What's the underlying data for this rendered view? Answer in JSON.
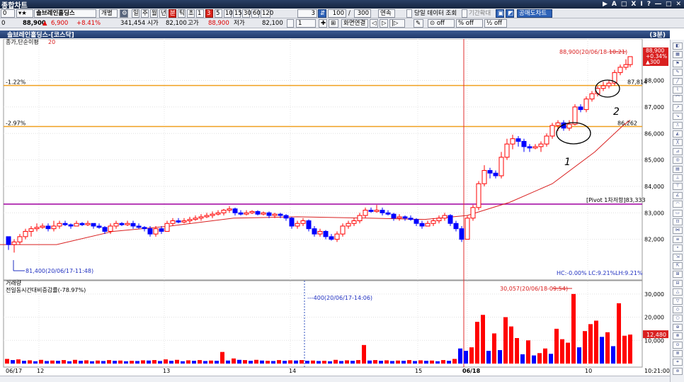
{
  "window": {
    "title": "종합차트",
    "controls": [
      "▶",
      "A",
      "□",
      "Ⅹ",
      "Ⅰ",
      "?",
      "―",
      "□",
      "✕"
    ]
  },
  "toolbar": {
    "code": "0",
    "stock_name": "솔브레인홀딩스",
    "individual_btn": "개별",
    "periods": [
      "일",
      "주",
      "월",
      "년",
      "분",
      "틱",
      "초",
      "1",
      "3",
      "5",
      "10",
      "15",
      "30",
      "60",
      "120"
    ],
    "selected_period": "분",
    "interval_value": "3",
    "count_value": "100",
    "count_total": "300",
    "continuous_btn": "연속",
    "today_data_label": "당일 데이터 조회",
    "period_expand_label": "기간확대",
    "buy_sell_btn": "공매도차트",
    "price": "88,900",
    "change_arrow": "▲",
    "change": "6,900",
    "change_pct": "+8.41%",
    "volume": "341,454",
    "open_label": "시가",
    "open": "82,100",
    "high_label": "고가",
    "high": "88,900",
    "low_label": "저가",
    "low": "82,100",
    "spin_value": "1",
    "screen_link_btn": "화면연결",
    "off_buttons": [
      "off",
      "off",
      "off"
    ]
  },
  "chart_caption": {
    "title": "솔브레인홀딩스-[코스닥]",
    "count": "(3분)"
  },
  "colors": {
    "up": "#ff0000",
    "down": "#0000ff",
    "ma": "#d92020",
    "hline_orange": "#f0a020",
    "pivot_line": "#a000a0",
    "vline": "#e03030"
  },
  "price_panel": {
    "label": "종가,단순이평",
    "ma_period": "20",
    "last_price_box": [
      "88,900",
      "+0.34%",
      "▲300"
    ],
    "annot_high": "88,900(20/06/18-10:21)",
    "annot_low": "81,400(20/06/17-11:48)",
    "line1_pct": "-1.22%",
    "line1_val": "87,814",
    "line2_pct": "-2.97%",
    "line2_val": "86,262",
    "pivot_label": "[Pivot 1차저항]83,333",
    "footer": [
      "HC:-0.00%",
      "LC:9.21%",
      "LH:9.21%"
    ],
    "y_ticks": [
      "88,000",
      "87,000",
      "86,000",
      "85,000",
      "84,000",
      "83,000",
      "82,000"
    ],
    "handwriting": [
      "1",
      "2"
    ]
  },
  "volume_panel": {
    "title": "거래량",
    "subtitle": "전일동시간대비증감률(-78.97%)",
    "annot_max": "30,057(20/06/18-09:54)",
    "annot_mark": "400(20/06/17-14:06)",
    "last_value_box": "12,480",
    "y_ticks": [
      "30,000",
      "20,000",
      "10,000"
    ]
  },
  "x_axis": {
    "labels": [
      "06/17",
      "12",
      "13",
      "14",
      "15",
      "06/18",
      "10",
      "10:21:00"
    ]
  },
  "chart_data": {
    "type": "candlestick",
    "y_range": [
      81.0,
      89.3
    ],
    "ma_points": [
      [
        0,
        81.8
      ],
      [
        20,
        81.8
      ],
      [
        80,
        81.8
      ],
      [
        160,
        82.3
      ],
      [
        240,
        82.5
      ],
      [
        330,
        82.8
      ],
      [
        420,
        82.85
      ],
      [
        520,
        82.8
      ],
      [
        600,
        82.75
      ],
      [
        660,
        82.9
      ],
      [
        720,
        83.4
      ],
      [
        780,
        84.1
      ],
      [
        840,
        85.3
      ],
      [
        880,
        86.3
      ],
      [
        890,
        86.5
      ]
    ],
    "candles": [
      [
        12,
        82.1,
        81.8,
        82.1,
        81.6
      ],
      [
        20,
        81.8,
        81.9,
        82.0,
        81.5
      ],
      [
        28,
        81.9,
        82.1,
        82.2,
        81.8
      ],
      [
        36,
        82.1,
        82.3,
        82.4,
        82.0
      ],
      [
        44,
        82.3,
        82.4,
        82.5,
        82.1
      ],
      [
        52,
        82.4,
        82.45,
        82.6,
        82.3
      ],
      [
        60,
        82.45,
        82.5,
        82.6,
        82.4
      ],
      [
        68,
        82.5,
        82.4,
        82.6,
        82.3
      ],
      [
        76,
        82.4,
        82.5,
        82.7,
        82.3
      ],
      [
        84,
        82.5,
        82.6,
        82.7,
        82.4
      ],
      [
        92,
        82.6,
        82.55,
        82.7,
        82.5
      ],
      [
        100,
        82.55,
        82.5,
        82.6,
        82.4
      ],
      [
        108,
        82.5,
        82.6,
        82.7,
        82.5
      ],
      [
        116,
        82.6,
        82.55,
        82.65,
        82.5
      ],
      [
        124,
        82.55,
        82.6,
        82.7,
        82.5
      ],
      [
        132,
        82.6,
        82.5,
        82.6,
        82.4
      ],
      [
        140,
        82.5,
        82.45,
        82.6,
        82.4
      ],
      [
        148,
        82.45,
        82.3,
        82.5,
        82.2
      ],
      [
        156,
        82.3,
        82.5,
        82.6,
        82.2
      ],
      [
        164,
        82.5,
        82.6,
        82.7,
        82.4
      ],
      [
        172,
        82.6,
        82.55,
        82.65,
        82.5
      ],
      [
        180,
        82.55,
        82.6,
        82.7,
        82.5
      ],
      [
        188,
        82.6,
        82.5,
        82.7,
        82.4
      ],
      [
        196,
        82.5,
        82.45,
        82.6,
        82.4
      ],
      [
        204,
        82.45,
        82.4,
        82.5,
        82.3
      ],
      [
        212,
        82.4,
        82.2,
        82.5,
        82.1
      ],
      [
        220,
        82.2,
        82.4,
        82.5,
        82.1
      ],
      [
        228,
        82.4,
        82.3,
        82.5,
        82.2
      ],
      [
        236,
        82.3,
        82.6,
        82.7,
        82.3
      ],
      [
        244,
        82.6,
        82.7,
        82.8,
        82.5
      ],
      [
        252,
        82.7,
        82.65,
        82.8,
        82.6
      ],
      [
        260,
        82.65,
        82.7,
        82.8,
        82.6
      ],
      [
        268,
        82.7,
        82.75,
        82.85,
        82.6
      ],
      [
        276,
        82.75,
        82.8,
        82.9,
        82.7
      ],
      [
        284,
        82.8,
        82.85,
        82.95,
        82.7
      ],
      [
        292,
        82.85,
        82.9,
        83.0,
        82.8
      ],
      [
        300,
        82.9,
        82.95,
        83.05,
        82.8
      ],
      [
        308,
        82.95,
        83.0,
        83.1,
        82.9
      ],
      [
        316,
        83.0,
        83.1,
        83.15,
        82.9
      ],
      [
        324,
        83.1,
        83.15,
        83.25,
        83.0
      ],
      [
        332,
        83.15,
        83.0,
        83.2,
        82.9
      ],
      [
        340,
        83.0,
        82.95,
        83.1,
        82.9
      ],
      [
        348,
        82.95,
        83.0,
        83.1,
        82.9
      ],
      [
        356,
        83.0,
        83.05,
        83.1,
        82.95
      ],
      [
        364,
        83.05,
        82.95,
        83.1,
        82.9
      ],
      [
        372,
        82.95,
        83.0,
        83.05,
        82.9
      ],
      [
        380,
        83.0,
        82.9,
        83.05,
        82.8
      ],
      [
        388,
        82.9,
        82.95,
        83.0,
        82.8
      ],
      [
        396,
        82.95,
        82.9,
        83.0,
        82.8
      ],
      [
        404,
        82.9,
        82.8,
        82.95,
        82.7
      ],
      [
        412,
        82.8,
        82.5,
        82.85,
        82.4
      ],
      [
        420,
        82.5,
        82.6,
        82.7,
        82.4
      ],
      [
        428,
        82.6,
        82.7,
        82.8,
        82.5
      ],
      [
        436,
        82.7,
        82.4,
        82.75,
        82.3
      ],
      [
        444,
        82.4,
        82.2,
        82.5,
        82.1
      ],
      [
        452,
        82.2,
        82.3,
        82.4,
        82.1
      ],
      [
        460,
        82.3,
        82.1,
        82.35,
        82.0
      ],
      [
        468,
        82.1,
        82.0,
        82.2,
        81.95
      ],
      [
        476,
        82.0,
        82.2,
        82.3,
        81.9
      ],
      [
        484,
        82.2,
        82.5,
        82.6,
        82.1
      ],
      [
        492,
        82.5,
        82.6,
        82.7,
        82.4
      ],
      [
        500,
        82.6,
        82.7,
        82.8,
        82.5
      ],
      [
        508,
        82.7,
        82.9,
        83.0,
        82.6
      ],
      [
        516,
        82.9,
        83.1,
        83.2,
        82.8
      ],
      [
        524,
        83.1,
        83.05,
        83.2,
        83.0
      ],
      [
        532,
        83.05,
        83.1,
        83.3,
        83.0
      ],
      [
        540,
        83.1,
        83.0,
        83.2,
        82.9
      ],
      [
        548,
        83.0,
        82.95,
        83.1,
        82.9
      ],
      [
        556,
        82.95,
        82.8,
        83.0,
        82.7
      ],
      [
        564,
        82.8,
        82.85,
        82.95,
        82.7
      ],
      [
        572,
        82.85,
        82.8,
        82.9,
        82.7
      ],
      [
        580,
        82.8,
        82.75,
        82.9,
        82.7
      ],
      [
        588,
        82.75,
        82.6,
        82.8,
        82.5
      ],
      [
        596,
        82.6,
        82.5,
        82.7,
        82.4
      ],
      [
        604,
        82.5,
        82.6,
        82.7,
        82.5
      ],
      [
        612,
        82.6,
        82.7,
        82.8,
        82.5
      ],
      [
        620,
        82.7,
        82.8,
        82.9,
        82.6
      ],
      [
        628,
        82.8,
        82.9,
        83.0,
        82.7
      ],
      [
        636,
        82.9,
        82.6,
        82.95,
        82.5
      ],
      [
        644,
        82.6,
        82.4,
        82.7,
        82.3
      ],
      [
        652,
        82.4,
        82.0,
        82.5,
        81.9
      ],
      [
        660,
        82.0,
        82.8,
        82.9,
        82.0
      ],
      [
        668,
        82.8,
        83.2,
        83.3,
        82.7
      ],
      [
        676,
        83.2,
        84.1,
        84.2,
        83.1
      ],
      [
        684,
        84.1,
        84.6,
        84.8,
        84.0
      ],
      [
        692,
        84.6,
        84.5,
        84.7,
        84.3
      ],
      [
        700,
        84.5,
        84.4,
        84.6,
        84.3
      ],
      [
        708,
        84.4,
        85.1,
        85.3,
        84.3
      ],
      [
        716,
        85.1,
        85.6,
        85.8,
        85.0
      ],
      [
        724,
        85.6,
        85.8,
        85.95,
        85.4
      ],
      [
        732,
        85.8,
        85.7,
        85.9,
        85.5
      ],
      [
        740,
        85.7,
        85.5,
        85.8,
        85.3
      ],
      [
        748,
        85.5,
        85.45,
        85.6,
        85.3
      ],
      [
        756,
        85.45,
        85.5,
        85.6,
        85.4
      ],
      [
        764,
        85.5,
        85.6,
        85.7,
        85.3
      ],
      [
        772,
        85.6,
        85.9,
        86.0,
        85.5
      ],
      [
        780,
        85.9,
        86.3,
        86.4,
        85.8
      ],
      [
        788,
        86.3,
        86.4,
        86.5,
        86.1
      ],
      [
        796,
        86.4,
        86.2,
        86.5,
        86.1
      ],
      [
        804,
        86.2,
        86.35,
        86.5,
        86.1
      ],
      [
        812,
        86.35,
        87.0,
        87.1,
        86.3
      ],
      [
        820,
        87.0,
        86.9,
        87.1,
        86.8
      ],
      [
        828,
        86.9,
        87.3,
        87.4,
        86.8
      ],
      [
        836,
        87.3,
        87.5,
        87.6,
        87.2
      ],
      [
        844,
        87.5,
        87.7,
        87.8,
        87.4
      ],
      [
        852,
        87.7,
        87.8,
        87.95,
        87.6
      ],
      [
        860,
        87.8,
        87.9,
        88.0,
        87.7
      ],
      [
        868,
        87.9,
        88.3,
        88.4,
        87.8
      ],
      [
        876,
        88.3,
        88.5,
        88.6,
        88.2
      ],
      [
        884,
        88.5,
        88.6,
        88.8,
        88.4
      ],
      [
        890,
        88.6,
        88.9,
        88.9,
        88.5
      ]
    ],
    "volume": [
      [
        10,
        1,
        2.0
      ],
      [
        18,
        0,
        1.5
      ],
      [
        26,
        1,
        1.8
      ],
      [
        34,
        0,
        1.2
      ],
      [
        42,
        1,
        1.4
      ],
      [
        50,
        0,
        1.0
      ],
      [
        58,
        1,
        1.6
      ],
      [
        66,
        0,
        1.1
      ],
      [
        74,
        1,
        1.3
      ],
      [
        82,
        0,
        1.2
      ],
      [
        90,
        1,
        1.5
      ],
      [
        98,
        0,
        1.0
      ],
      [
        106,
        1,
        1.6
      ],
      [
        114,
        0,
        1.2
      ],
      [
        122,
        1,
        1.4
      ],
      [
        130,
        0,
        1.0
      ],
      [
        138,
        1,
        1.3
      ],
      [
        146,
        0,
        1.1
      ],
      [
        154,
        1,
        1.5
      ],
      [
        162,
        0,
        1.2
      ],
      [
        170,
        1,
        1.3
      ],
      [
        178,
        0,
        1.0
      ],
      [
        186,
        1,
        1.2
      ],
      [
        194,
        0,
        1.1
      ],
      [
        202,
        1,
        1.4
      ],
      [
        210,
        0,
        1.3
      ],
      [
        218,
        1,
        1.5
      ],
      [
        226,
        0,
        1.1
      ],
      [
        234,
        1,
        1.8
      ],
      [
        242,
        0,
        1.2
      ],
      [
        250,
        1,
        1.6
      ],
      [
        258,
        0,
        1.0
      ],
      [
        266,
        1,
        1.4
      ],
      [
        274,
        0,
        1.2
      ],
      [
        282,
        1,
        1.5
      ],
      [
        290,
        0,
        1.1
      ],
      [
        298,
        1,
        1.3
      ],
      [
        306,
        0,
        1.2
      ],
      [
        314,
        1,
        5.0
      ],
      [
        322,
        0,
        1.3
      ],
      [
        330,
        1,
        2.2
      ],
      [
        338,
        0,
        1.6
      ],
      [
        346,
        1,
        1.5
      ],
      [
        354,
        0,
        1.2
      ],
      [
        362,
        1,
        1.6
      ],
      [
        370,
        0,
        1.3
      ],
      [
        378,
        1,
        1.2
      ],
      [
        386,
        0,
        1.1
      ],
      [
        394,
        1,
        1.5
      ],
      [
        402,
        0,
        1.2
      ],
      [
        410,
        1,
        1.4
      ],
      [
        418,
        0,
        1.3
      ],
      [
        426,
        1,
        1.5
      ],
      [
        434,
        0,
        1.2
      ],
      [
        442,
        1,
        1.3
      ],
      [
        450,
        0,
        1.1
      ],
      [
        458,
        1,
        1.2
      ],
      [
        466,
        0,
        1.0
      ],
      [
        474,
        1,
        1.6
      ],
      [
        482,
        0,
        1.1
      ],
      [
        490,
        1,
        1.4
      ],
      [
        498,
        0,
        1.2
      ],
      [
        506,
        1,
        1.5
      ],
      [
        514,
        1,
        8.0
      ],
      [
        522,
        0,
        1.3
      ],
      [
        530,
        1,
        1.5
      ],
      [
        538,
        0,
        1.2
      ],
      [
        546,
        1,
        1.4
      ],
      [
        554,
        0,
        1.1
      ],
      [
        562,
        1,
        1.3
      ],
      [
        570,
        0,
        1.2
      ],
      [
        578,
        1,
        1.5
      ],
      [
        586,
        0,
        1.1
      ],
      [
        594,
        1,
        1.4
      ],
      [
        602,
        0,
        1.2
      ],
      [
        610,
        1,
        1.3
      ],
      [
        618,
        0,
        1.0
      ],
      [
        626,
        1,
        1.5
      ],
      [
        634,
        0,
        1.2
      ],
      [
        642,
        1,
        2.0
      ],
      [
        650,
        0,
        6.5
      ],
      [
        658,
        0,
        5.5
      ],
      [
        666,
        1,
        7.0
      ],
      [
        674,
        1,
        18.0
      ],
      [
        682,
        1,
        21.0
      ],
      [
        690,
        0,
        5.5
      ],
      [
        698,
        1,
        13.0
      ],
      [
        706,
        0,
        5.8
      ],
      [
        714,
        1,
        20.0
      ],
      [
        722,
        1,
        16.0
      ],
      [
        730,
        1,
        11.0
      ],
      [
        738,
        0,
        4.0
      ],
      [
        746,
        1,
        10.0
      ],
      [
        754,
        0,
        3.5
      ],
      [
        762,
        1,
        4.5
      ],
      [
        770,
        1,
        6.5
      ],
      [
        778,
        0,
        4.2
      ],
      [
        786,
        1,
        15.0
      ],
      [
        794,
        1,
        10.5
      ],
      [
        802,
        1,
        9.0
      ],
      [
        810,
        1,
        30.0
      ],
      [
        818,
        0,
        7.0
      ],
      [
        826,
        1,
        14.0
      ],
      [
        834,
        1,
        17.0
      ],
      [
        842,
        1,
        18.5
      ],
      [
        850,
        0,
        11.5
      ],
      [
        858,
        1,
        13.5
      ],
      [
        866,
        0,
        7.5
      ],
      [
        874,
        1,
        26.0
      ],
      [
        882,
        1,
        12.0
      ],
      [
        890,
        1,
        12.5
      ]
    ]
  }
}
